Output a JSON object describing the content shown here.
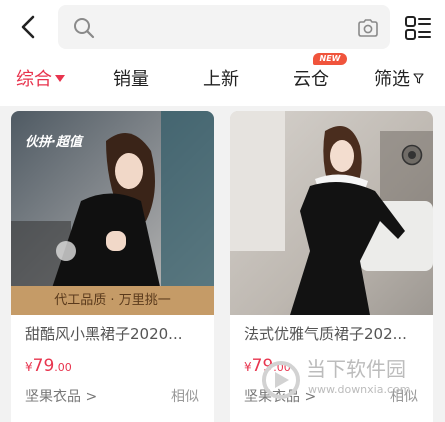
{
  "header": {
    "back": "back-arrow-icon",
    "search_icon": "search-icon",
    "camera_icon": "camera-icon",
    "menu_icon": "list-view-icon"
  },
  "sort_tabs": [
    {
      "label": "综合",
      "active": true,
      "icon": "triangle-down-icon"
    },
    {
      "label": "销量"
    },
    {
      "label": "上新"
    },
    {
      "label": "云仓",
      "badge": "NEW"
    },
    {
      "label": "筛选",
      "icon": "filter-icon"
    }
  ],
  "products": [
    {
      "title": "甜酷风小黑裙子2020...",
      "price_symbol": "¥",
      "price_int": "79",
      "price_dec": ".00",
      "shop": "坚果衣品 >",
      "similar": "相似",
      "image_tag": "伙拼·超值",
      "image_banner": "代工品质 · 万里挑一"
    },
    {
      "title": "法式优雅气质裙子202...",
      "price_symbol": "¥",
      "price_int": "79",
      "price_dec": ".00",
      "shop": "坚果衣品 >",
      "similar": "相似"
    }
  ],
  "watermark": {
    "text": "当下软件园",
    "url": "www.downxia.com"
  },
  "colors": {
    "accent": "#e8344e",
    "badge": "#f0543c",
    "background": "#f2f2f2"
  }
}
